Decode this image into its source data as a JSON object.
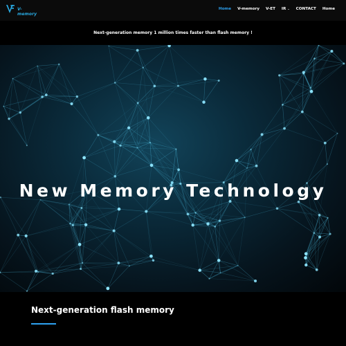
{
  "brand": {
    "name": "V-memory"
  },
  "nav": {
    "items": [
      {
        "label": "Home",
        "active": true,
        "dropdown": false
      },
      {
        "label": "V-memory",
        "active": false,
        "dropdown": false
      },
      {
        "label": "V-ET",
        "active": false,
        "dropdown": false
      },
      {
        "label": "IR",
        "active": false,
        "dropdown": true
      },
      {
        "label": "CONTACT",
        "active": false,
        "dropdown": false
      },
      {
        "label": "Home",
        "active": false,
        "dropdown": false
      }
    ]
  },
  "tagline": "Next-generation memory 1 million times faster than flash memory !",
  "hero": {
    "title": "New Memory Technology"
  },
  "section": {
    "heading": "Next-generation flash memory"
  },
  "colors": {
    "accent": "#2ea3f2",
    "logo": "#29a9e1",
    "background": "#000000"
  }
}
